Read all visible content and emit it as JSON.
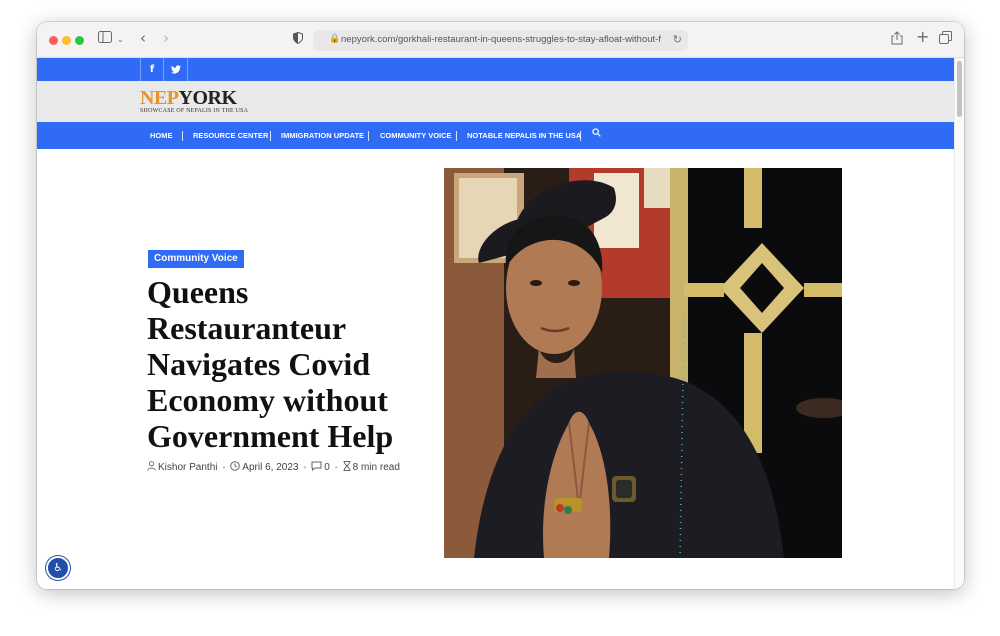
{
  "browser": {
    "url": "nepyork.com/gorkhali-restaurant-in-queens-struggles-to-stay-afloat-without-feder",
    "icons": [
      "sidebar-icon",
      "back-icon",
      "forward-icon",
      "privacy-shield-icon",
      "lock-icon",
      "reload-icon",
      "share-icon",
      "new-tab-icon",
      "tabs-overview-icon"
    ]
  },
  "site": {
    "logo_nep": "NEP",
    "logo_york": "YORK",
    "tagline": "SHOWCASE OF NEPALIS IN THE USA",
    "social": {
      "facebook": "f",
      "twitter": "t"
    },
    "brand_color": "#2f6bf5",
    "logo_accent": "#e8932a"
  },
  "nav": {
    "items": [
      {
        "label": "HOME"
      },
      {
        "label": "RESOURCE CENTER"
      },
      {
        "label": "IMMIGRATION UPDATE"
      },
      {
        "label": "COMMUNITY VOICE"
      },
      {
        "label": "NOTABLE NEPALIS IN THE USA"
      }
    ],
    "search_icon": "search-icon"
  },
  "article": {
    "category": "Community Voice",
    "title": "Queens Restauranteur Navigates Covid Economy without Government Help",
    "author": "Kishor Panthi",
    "date": "April 6, 2023",
    "comments": "0",
    "read_time": "8 min read"
  }
}
